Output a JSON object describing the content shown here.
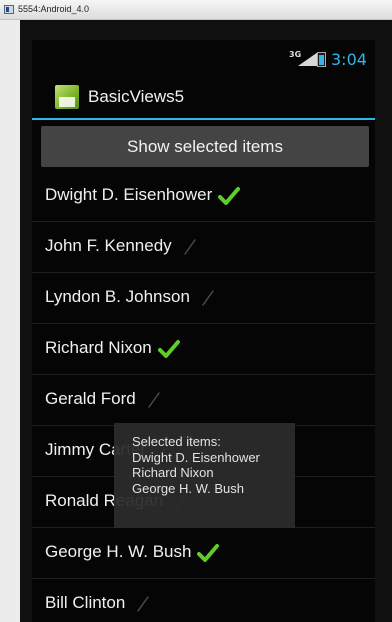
{
  "window": {
    "title": "5554:Android_4.0"
  },
  "status": {
    "network": "3G",
    "time": "3:04"
  },
  "app": {
    "title": "BasicViews5"
  },
  "button": {
    "label": "Show selected items"
  },
  "list": {
    "items": [
      {
        "label": "Dwight D. Eisenhower",
        "checked": true
      },
      {
        "label": "John F. Kennedy",
        "checked": false
      },
      {
        "label": "Lyndon B. Johnson",
        "checked": false
      },
      {
        "label": "Richard Nixon",
        "checked": true
      },
      {
        "label": "Gerald Ford",
        "checked": false
      },
      {
        "label": "Jimmy Carter",
        "checked": false
      },
      {
        "label": "Ronald Reagan",
        "checked": false
      },
      {
        "label": "George H. W. Bush",
        "checked": true
      },
      {
        "label": "Bill Clinton",
        "checked": false
      }
    ]
  },
  "toast": {
    "title": "Selected items:",
    "lines": [
      "Dwight D. Eisenhower",
      "Richard Nixon",
      "George H. W. Bush"
    ]
  },
  "colors": {
    "accent": "#33b5e5",
    "check": "#5fce2c",
    "unchecked": "#4a4a4a"
  }
}
